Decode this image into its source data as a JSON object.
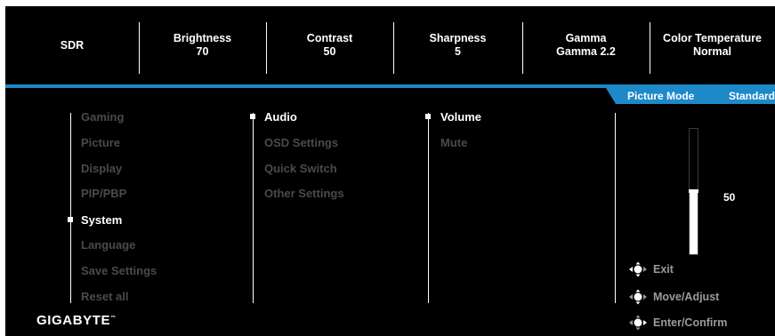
{
  "topbar": {
    "items": [
      {
        "label": "SDR",
        "value": ""
      },
      {
        "label": "Brightness",
        "value": "70"
      },
      {
        "label": "Contrast",
        "value": "50"
      },
      {
        "label": "Sharpness",
        "value": "5"
      },
      {
        "label": "Gamma",
        "value": "Gamma 2.2"
      },
      {
        "label": "Color Temperature",
        "value": "Normal"
      }
    ]
  },
  "picture_mode": {
    "label": "Picture Mode",
    "value": "Standard"
  },
  "main_menu": {
    "items": [
      "Gaming",
      "Picture",
      "Display",
      "PIP/PBP",
      "System",
      "Language",
      "Save Settings",
      "Reset all"
    ],
    "selected": "System"
  },
  "sub_menu": {
    "items": [
      "Audio",
      "OSD Settings",
      "Quick Switch",
      "Other Settings"
    ],
    "selected": "Audio"
  },
  "third_menu": {
    "items": [
      "Volume",
      "Mute"
    ],
    "selected": "Volume"
  },
  "volume": {
    "value": "50",
    "level": 0.5
  },
  "hints": {
    "exit": "Exit",
    "move": "Move/Adjust",
    "enter": "Enter/Confirm"
  },
  "brand": {
    "name": "GIGABYTE",
    "tm": "™"
  },
  "colors": {
    "accent": "#1d89c8",
    "background": "#000000",
    "active_text": "#ffffff",
    "inactive_text": "#4a4a4a",
    "hint_text": "#9a9a9a"
  },
  "icons": {
    "joystick": "joystick-icon"
  }
}
